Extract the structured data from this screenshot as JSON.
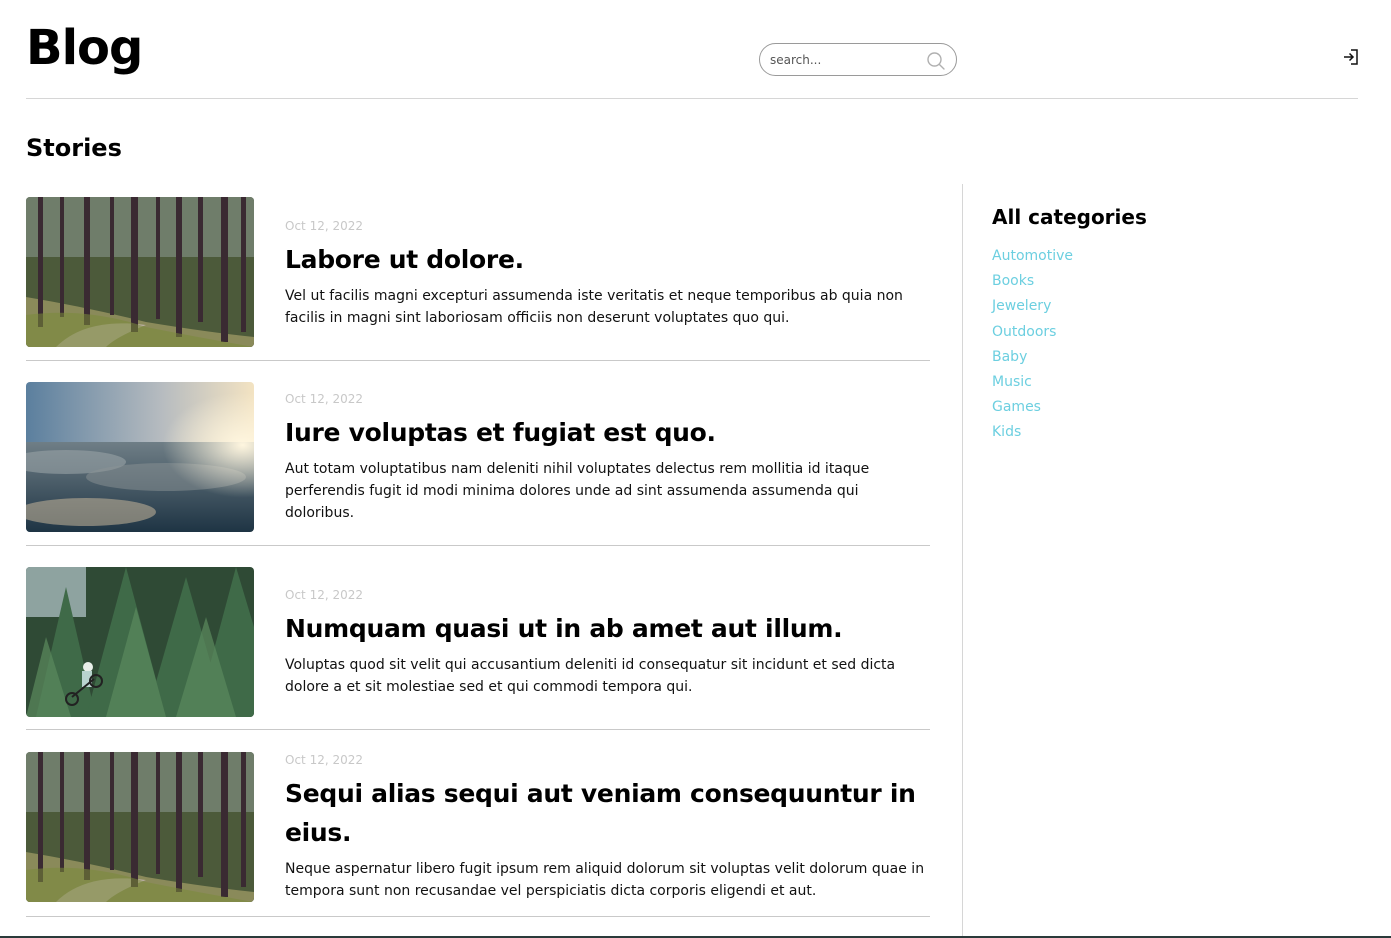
{
  "header": {
    "logo": "Blog",
    "search_placeholder": "search..."
  },
  "main": {
    "section_title": "Stories",
    "stories": [
      {
        "date": "Oct 12, 2022",
        "title": "Labore ut dolore.",
        "excerpt": "Vel ut facilis magni excepturi assumenda iste veritatis et neque temporibus ab quia non facilis in magni sint laboriosam officiis non deserunt voluptates quo qui.",
        "image": "forest-path"
      },
      {
        "date": "Oct 12, 2022",
        "title": "Iure voluptas et fugiat est quo.",
        "excerpt": "Aut totam voluptatibus nam deleniti nihil voluptates delectus rem mollitia id itaque perferendis fugit id modi minima dolores unde ad sint assumenda assumenda qui doloribus.",
        "image": "clouds-sunrise"
      },
      {
        "date": "Oct 12, 2022",
        "title": "Numquam quasi ut in ab amet aut illum.",
        "excerpt": "Voluptas quod sit velit qui accusantium deleniti id consequatur sit incidunt et sed dicta dolore a et sit molestiae sed et qui commodi tempora qui.",
        "image": "mountain-biker-forest"
      },
      {
        "date": "Oct 12, 2022",
        "title": "Sequi alias sequi aut veniam consequuntur in eius.",
        "excerpt": "Neque aspernatur libero fugit ipsum rem aliquid dolorum sit voluptas velit dolorum quae in tempora sunt non recusandae vel perspiciatis dicta corporis eligendi et aut.",
        "image": "forest-path"
      }
    ]
  },
  "sidebar": {
    "title": "All categories",
    "categories": [
      "Automotive",
      "Books",
      "Jewelery",
      "Outdoors",
      "Baby",
      "Music",
      "Games",
      "Kids"
    ]
  },
  "colors": {
    "category_link": "#6ccfe0",
    "date": "#c8c8c8",
    "divider": "#d6d6d6"
  },
  "icons": {
    "search": "search-icon",
    "login": "login-icon"
  }
}
